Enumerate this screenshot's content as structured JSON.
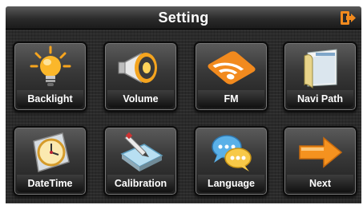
{
  "header": {
    "title": "Setting",
    "exit_icon": "exit-icon"
  },
  "colors": {
    "accent_orange": "#f28a1e",
    "panel_background": "#2a2a2a"
  },
  "tiles": [
    {
      "label": "Backlight",
      "icon": "lightbulb-icon"
    },
    {
      "label": "Volume",
      "icon": "megaphone-icon"
    },
    {
      "label": "FM",
      "icon": "rss-feed-icon"
    },
    {
      "label": "Navi Path",
      "icon": "folder-path-icon"
    },
    {
      "label": "DateTime",
      "icon": "clock-icon"
    },
    {
      "label": "Calibration",
      "icon": "calibration-pen-icon"
    },
    {
      "label": "Language",
      "icon": "chat-bubbles-icon"
    },
    {
      "label": "Next",
      "icon": "arrow-right-icon"
    }
  ]
}
